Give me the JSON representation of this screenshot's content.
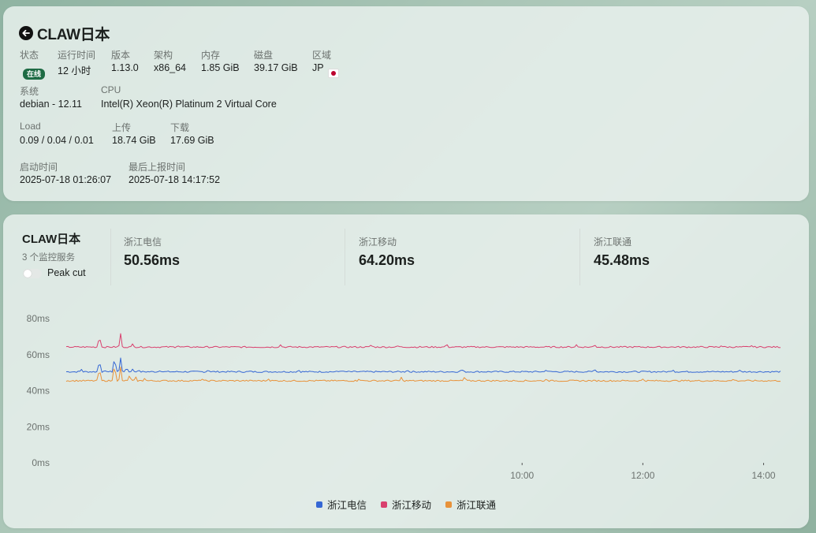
{
  "server": {
    "name": "CLAW日本",
    "status_label": "状态",
    "status_value": "在线",
    "uptime_label": "运行时间",
    "uptime_value": "12 小时",
    "version_label": "版本",
    "version_value": "1.13.0",
    "arch_label": "架构",
    "arch_value": "x86_64",
    "memory_label": "内存",
    "memory_value": "1.85 GiB",
    "disk_label": "磁盘",
    "disk_value": "39.17 GiB",
    "region_label": "区域",
    "region_value": "JP",
    "os_label": "系统",
    "os_value": "debian - 12.11",
    "cpu_label": "CPU",
    "cpu_value": "Intel(R) Xeon(R) Platinum 2 Virtual Core",
    "load_label": "Load",
    "load_value": "0.09 / 0.04 / 0.01",
    "upload_label": "上传",
    "upload_value": "18.74 GiB",
    "download_label": "下载",
    "download_value": "17.69 GiB",
    "boot_label": "启动时间",
    "boot_value": "2025-07-18 01:26:07",
    "report_label": "最后上报时间",
    "report_value": "2025-07-18 14:17:52"
  },
  "monitor": {
    "title": "CLAW日本",
    "subtitle": "3 个监控服务",
    "peak_cut_label": "Peak cut",
    "peak_cut_enabled": false,
    "stats": [
      {
        "label": "浙江电信",
        "value": "50.56ms"
      },
      {
        "label": "浙江移动",
        "value": "64.20ms"
      },
      {
        "label": "浙江联通",
        "value": "45.48ms"
      }
    ]
  },
  "colors": {
    "telecom": "#3567d4",
    "mobile": "#d9406e",
    "unicom": "#e8923a",
    "status_green": "#1e6b44"
  },
  "chart_data": {
    "type": "line",
    "ylabel_unit": "ms",
    "ylim": [
      0,
      80
    ],
    "yticks": [
      "0ms",
      "20ms",
      "40ms",
      "60ms",
      "80ms"
    ],
    "ytick_values": [
      0,
      20,
      40,
      60,
      80
    ],
    "xlim_hours": [
      2.45,
      14.28
    ],
    "xticks": [
      "10:00",
      "12:00",
      "14:00"
    ],
    "xtick_values": [
      10,
      12,
      14
    ],
    "legend_position": "bottom-center",
    "grid": false,
    "series": [
      {
        "name": "浙江电信",
        "color": "#3567d4",
        "baseline": 50.5,
        "spikes": [
          [
            2.7,
            52
          ],
          [
            3.0,
            57.5
          ],
          [
            3.1,
            51
          ],
          [
            3.25,
            59.5
          ],
          [
            3.35,
            58.5
          ],
          [
            3.45,
            53
          ],
          [
            3.55,
            52
          ],
          [
            3.65,
            51.5
          ],
          [
            4.0,
            51
          ],
          [
            4.8,
            51.5
          ],
          [
            5.5,
            51
          ],
          [
            6.3,
            51.5
          ],
          [
            7.0,
            51
          ],
          [
            8.1,
            51.5
          ],
          [
            9.0,
            52
          ],
          [
            10.4,
            51.5
          ],
          [
            11.2,
            52
          ],
          [
            12.5,
            51.5
          ],
          [
            13.6,
            51.5
          ]
        ]
      },
      {
        "name": "浙江移动",
        "color": "#d9406e",
        "baseline": 64.2,
        "spikes": [
          [
            3.0,
            71
          ],
          [
            3.35,
            72
          ],
          [
            3.55,
            66
          ],
          [
            4.3,
            65
          ],
          [
            6.0,
            65.5
          ],
          [
            7.5,
            65.5
          ],
          [
            7.95,
            65
          ],
          [
            8.75,
            66
          ],
          [
            10.9,
            65.5
          ],
          [
            11.2,
            65.5
          ],
          [
            13.3,
            65
          ],
          [
            13.8,
            65
          ]
        ]
      },
      {
        "name": "浙江联通",
        "color": "#e8923a",
        "baseline": 45.5,
        "spikes": [
          [
            3.0,
            53.5
          ],
          [
            3.25,
            56
          ],
          [
            3.35,
            53.5
          ],
          [
            3.5,
            49
          ],
          [
            3.6,
            48
          ],
          [
            3.75,
            47
          ],
          [
            4.7,
            46.5
          ],
          [
            5.8,
            46.5
          ],
          [
            7.3,
            46.5
          ],
          [
            8.0,
            47.5
          ],
          [
            9.05,
            48
          ],
          [
            10.4,
            46.5
          ],
          [
            12.0,
            46.5
          ],
          [
            13.5,
            46.5
          ]
        ]
      }
    ]
  }
}
